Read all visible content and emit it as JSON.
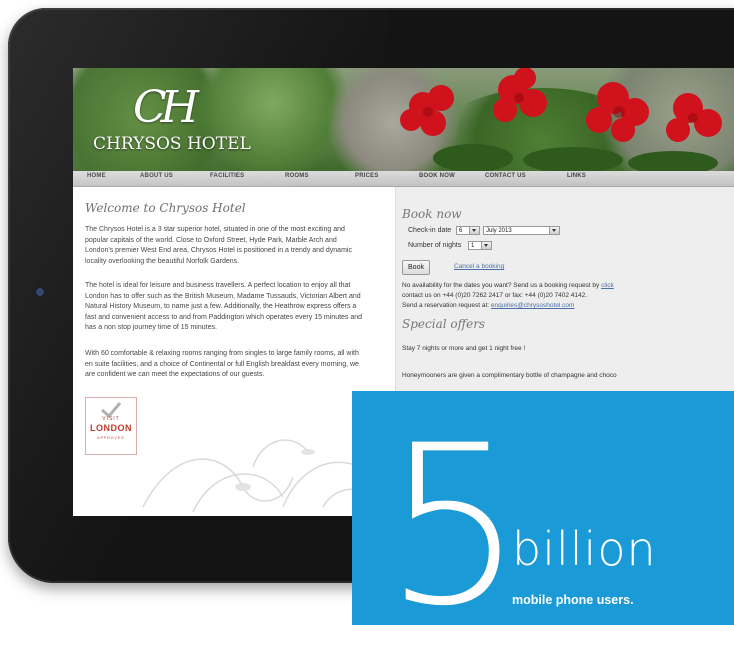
{
  "site": {
    "logo_text": "Chrysos Hotel",
    "logo_monogram": "CH"
  },
  "nav": [
    "HOME",
    "ABOUT US",
    "FACILITIES",
    "ROOMS",
    "PRICES",
    "BOOK NOW",
    "CONTACT US",
    "LINKS"
  ],
  "main": {
    "welcome_title": "Welcome to Chrysos Hotel",
    "paragraphs": [
      [
        "The Chrysos Hotel is a 3 star superior hotel, situated in one of the most exciting and",
        "popular capitals of the world. Close to Oxford Street, Hyde Park, Marble Arch and",
        "London's premier West End area, Chrysos Hotel is positioned in a trendy and dynamic",
        "locality overlooking the beautiful Norfolk Gardens."
      ],
      [
        "The hotel is ideal for leisure and business travellers. A perfect location to enjoy all that",
        "London has to offer such as the British Museum, Madame Tussauds, Victorian Albert and",
        "Natural History Museum, to name just a few. Additionally, the Heathrow express offers a",
        "fast and convenient access to and from Paddington which operates every 15 minutes and",
        "has a non stop journey time of 15 minutes."
      ],
      [
        "With 60 comfortable & relaxing rooms ranging from singles to large family rooms, all with",
        "en suite facilities, and a choice of Continental or full English breakfast every morning, we",
        "are confident we can meet the expectations of our guests."
      ]
    ],
    "badge": {
      "top": "VISIT",
      "main": "LONDON",
      "bottom": "APPROVED"
    }
  },
  "booking": {
    "title": "Book now",
    "checkin_label": "Check-in date",
    "checkin_day": "6",
    "checkin_month": "July 2013",
    "nights_label": "Number of nights",
    "nights_value": "1",
    "book_button": "Book",
    "cancel_link": "Cancel a booking",
    "availability": "No availability for the dates you want? Send us a booking request by",
    "availability_link": "click",
    "contact_line": "contact us on +44 (0)20 7262 2417 or fax: +44 (0)20 7402 4142.",
    "reservation_prefix": "Send a reservation request at:",
    "reservation_email": "enquiries@chrysoshotel.com"
  },
  "offers": {
    "title": "Special offers",
    "items": [
      "Stay 7 nights or more and get 1 night free !",
      "Honeymooners are given a complimentary bottle of champagne and choco"
    ]
  },
  "promo": {
    "number": "5",
    "unit": "billion",
    "caption": "mobile phone users.",
    "color": "#1a9ad6"
  }
}
